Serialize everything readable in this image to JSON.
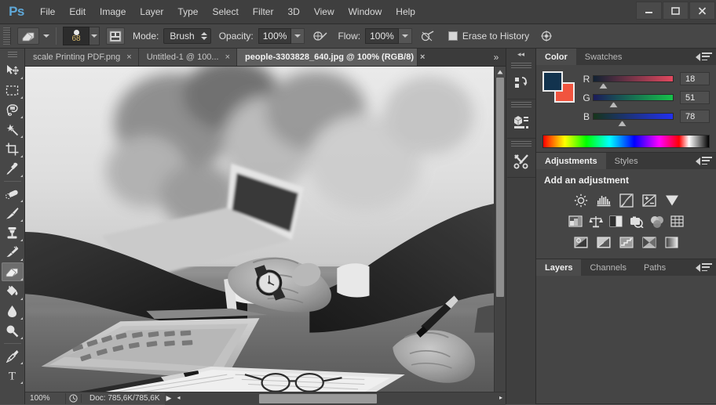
{
  "app": {
    "logo": "Ps",
    "title": "Adobe Photoshop"
  },
  "menubar": {
    "items": [
      {
        "label": "File"
      },
      {
        "label": "Edit"
      },
      {
        "label": "Image"
      },
      {
        "label": "Layer"
      },
      {
        "label": "Type"
      },
      {
        "label": "Select"
      },
      {
        "label": "Filter"
      },
      {
        "label": "3D"
      },
      {
        "label": "View"
      },
      {
        "label": "Window"
      },
      {
        "label": "Help"
      }
    ],
    "window_controls": [
      {
        "name": "minimize",
        "glyph": "—"
      },
      {
        "name": "maximize",
        "glyph": "❐"
      },
      {
        "name": "close",
        "glyph": "✕"
      }
    ]
  },
  "options_bar": {
    "tool_icon": "eraser-icon",
    "brush_size": "68",
    "mode_label": "Mode:",
    "mode_value": "Brush",
    "opacity_label": "Opacity:",
    "opacity_value": "100%",
    "flow_label": "Flow:",
    "flow_value": "100%",
    "erase_to_history_label": "Erase to History",
    "erase_to_history_checked": false
  },
  "toolbar": {
    "selected": "eraser",
    "tools": [
      {
        "name": "move-tool",
        "label": "Move Tool"
      },
      {
        "name": "rectangular-marquee-tool",
        "label": "Rectangular Marquee Tool"
      },
      {
        "name": "lasso-tool",
        "label": "Lasso Tool"
      },
      {
        "name": "magic-wand-tool",
        "label": "Magic Wand Tool"
      },
      {
        "name": "crop-tool",
        "label": "Crop Tool"
      },
      {
        "name": "eyedropper-tool",
        "label": "Eyedropper Tool"
      },
      {
        "name": "spot-healing-brush-tool",
        "label": "Spot Healing Brush Tool"
      },
      {
        "name": "brush-tool",
        "label": "Brush Tool"
      },
      {
        "name": "clone-stamp-tool",
        "label": "Clone Stamp Tool"
      },
      {
        "name": "history-brush-tool",
        "label": "History Brush Tool"
      },
      {
        "name": "eraser-tool",
        "label": "Eraser Tool"
      },
      {
        "name": "paint-bucket-tool",
        "label": "Paint Bucket Tool"
      },
      {
        "name": "blur-tool",
        "label": "Blur Tool"
      },
      {
        "name": "dodge-tool",
        "label": "Dodge Tool"
      },
      {
        "name": "pen-tool",
        "label": "Pen Tool"
      },
      {
        "name": "horizontal-type-tool",
        "label": "Horizontal Type Tool"
      }
    ]
  },
  "document_tabs": {
    "overflow_glyph": "»",
    "tabs": [
      {
        "label": "scale Printing PDF.png",
        "active": false,
        "close": "×"
      },
      {
        "label": "Untitled-1 @ 100...",
        "active": false,
        "close": "×"
      },
      {
        "label": "people-3303828_640.jpg @ 100% (RGB/8)",
        "active": true,
        "close": "×"
      }
    ]
  },
  "canvas": {
    "image_description": "grayscale photo of two people shaking hands over a desk with laptop, papers and pen",
    "scrollbars": {
      "vertical": true,
      "horizontal": true
    }
  },
  "status_bar": {
    "zoom": "100%",
    "doc_label": "Doc: 785,6K/785,6K",
    "play_glyph": "▶",
    "arrow_glyph": "◂"
  },
  "dock_strip": {
    "collapse_glyph": "◂◂",
    "buttons": [
      {
        "name": "history-panel-icon",
        "label": "History"
      },
      {
        "name": "mini-bridge-panel-icon",
        "label": "Mini Bridge"
      },
      {
        "name": "tool-presets-panel-icon",
        "label": "Tool Presets"
      }
    ]
  },
  "panels": {
    "color": {
      "tabs": [
        {
          "label": "Color",
          "active": true
        },
        {
          "label": "Swatches",
          "active": false
        }
      ],
      "foreground_color": "#12334E",
      "background_color": "#F1543F",
      "channels": [
        {
          "label": "R",
          "value": "18",
          "pos": 7
        },
        {
          "label": "G",
          "value": "51",
          "pos": 20
        },
        {
          "label": "B",
          "value": "78",
          "pos": 31
        }
      ]
    },
    "adjustments": {
      "tabs": [
        {
          "label": "Adjustments",
          "active": true
        },
        {
          "label": "Styles",
          "active": false
        }
      ],
      "title": "Add an adjustment",
      "rows": [
        [
          {
            "name": "brightness-contrast-icon",
            "label": "Brightness/Contrast"
          },
          {
            "name": "levels-icon",
            "label": "Levels"
          },
          {
            "name": "curves-icon",
            "label": "Curves"
          },
          {
            "name": "exposure-icon",
            "label": "Exposure"
          },
          {
            "name": "vibrance-icon",
            "label": "Vibrance"
          }
        ],
        [
          {
            "name": "hue-saturation-icon",
            "label": "Hue/Saturation"
          },
          {
            "name": "color-balance-icon",
            "label": "Color Balance"
          },
          {
            "name": "black-white-icon",
            "label": "Black & White"
          },
          {
            "name": "photo-filter-icon",
            "label": "Photo Filter"
          },
          {
            "name": "channel-mixer-icon",
            "label": "Channel Mixer"
          },
          {
            "name": "color-lookup-icon",
            "label": "Color Lookup"
          }
        ],
        [
          {
            "name": "invert-icon",
            "label": "Invert"
          },
          {
            "name": "posterize-icon",
            "label": "Posterize"
          },
          {
            "name": "threshold-icon",
            "label": "Threshold"
          },
          {
            "name": "selective-color-icon",
            "label": "Selective Color"
          },
          {
            "name": "gradient-map-icon",
            "label": "Gradient Map"
          }
        ]
      ]
    },
    "layers": {
      "tabs": [
        {
          "label": "Layers",
          "active": true
        },
        {
          "label": "Channels",
          "active": false
        },
        {
          "label": "Paths",
          "active": false
        }
      ]
    }
  }
}
